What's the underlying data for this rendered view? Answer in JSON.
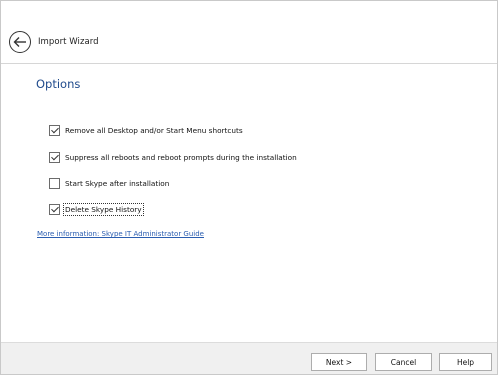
{
  "window": {
    "close_glyph": "✕"
  },
  "header": {
    "title": "Import Wizard",
    "back_icon": "back-arrow-icon"
  },
  "content": {
    "section_title": "Options",
    "options": [
      {
        "label": "Remove all Desktop and/or Start Menu shortcuts",
        "checked": true
      },
      {
        "label": "Suppress all reboots and reboot prompts during the installation",
        "checked": true
      },
      {
        "label": "Start Skype after installation",
        "checked": false
      },
      {
        "label": "Delete Skype History",
        "checked": true
      }
    ],
    "more_info_link": "More information: Skype IT Administrator Guide"
  },
  "footer": {
    "next_label": "Next >",
    "cancel_label": "Cancel",
    "help_label": "Help"
  },
  "colors": {
    "accent": "#1f4a8c",
    "link": "#2a5db0",
    "footer_bg": "#f0f0f0"
  }
}
